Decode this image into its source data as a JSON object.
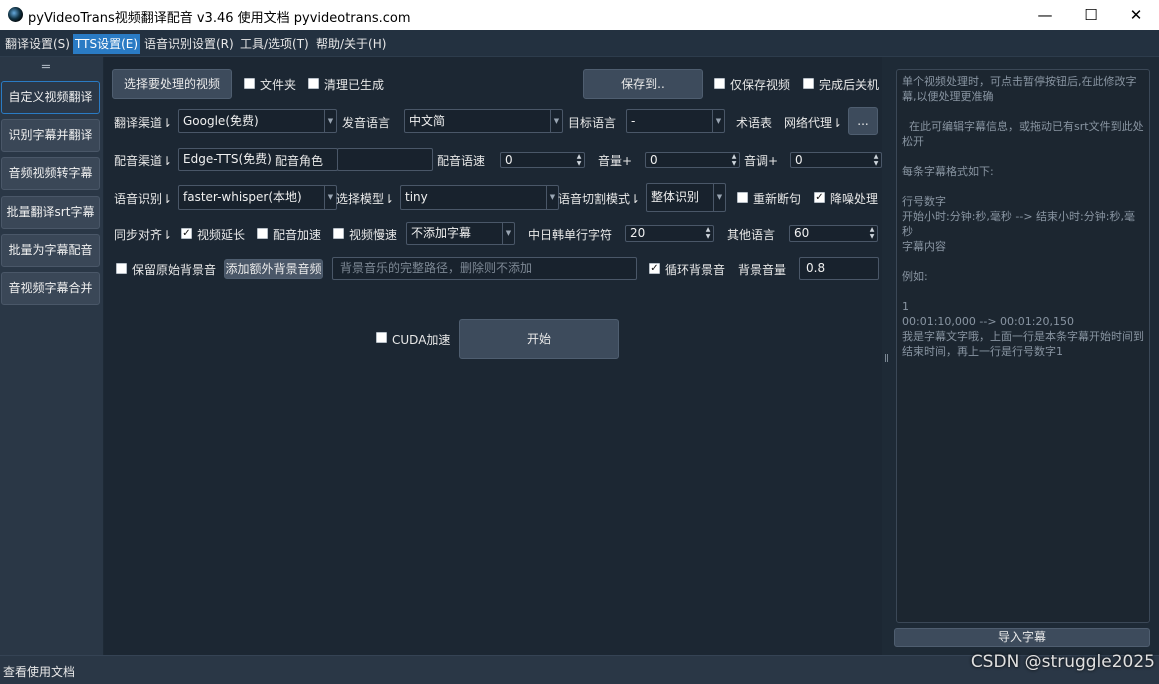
{
  "window": {
    "title": "pyVideoTrans视频翻译配音 v3.46  使用文档  pyvideotrans.com",
    "min": "—",
    "max": "☐",
    "close": "✕"
  },
  "menu": [
    "翻译设置(S)",
    "TTS设置(E)",
    "语音识别设置(R)",
    "工具/选项(T)",
    "帮助/关于(H)"
  ],
  "sidebar": {
    "handle": "═",
    "items": [
      "自定义视频翻译",
      "识别字幕并翻译",
      "音频视频转字幕",
      "批量翻译srt字幕",
      "批量为字幕配音",
      "音视频字幕合并"
    ]
  },
  "row1": {
    "select_video": "选择要处理的视频",
    "folder": "文件夹",
    "clean": "清理已生成",
    "save_to": "保存到..",
    "only_video": "仅保存视频",
    "shutdown": "完成后关机"
  },
  "row2": {
    "translate_label": "翻译渠道⇂",
    "translate_value": "Google(免费)",
    "voice_lang_label": "发音语言",
    "voice_lang_value": "中文简",
    "target_lang_label": "目标语言",
    "target_lang_value": "-",
    "glossary": "术语表",
    "proxy": "网络代理⇂",
    "more": "..."
  },
  "row3": {
    "dub_label": "配音渠道⇂",
    "dub_value": "Edge-TTS(免费)",
    "role_label": "配音角色",
    "role_value": "",
    "rate_label": "配音语速",
    "rate_value": "0",
    "volume_label": "音量+",
    "volume_value": "0",
    "pitch_label": "音调+",
    "pitch_value": "0"
  },
  "row4": {
    "asr_label": "语音识别⇂",
    "asr_value": "faster-whisper(本地)",
    "model_label": "选择模型⇂",
    "model_value": "tiny",
    "split_label": "语音切割模式⇂",
    "split_value": "整体识别",
    "resplit": "重新断句",
    "denoise": "降噪处理"
  },
  "row5": {
    "sync_label": "同步对齐⇂",
    "extend": "视频延长",
    "speedup": "配音加速",
    "slow": "视频慢速",
    "subtitle_value": "不添加字幕",
    "cjk_label": "中日韩单行字符",
    "cjk_value": "20",
    "other_label": "其他语言",
    "other_value": "60"
  },
  "row6": {
    "keep_bg": "保留原始背景音",
    "add_bg": "添加额外背景音频",
    "bg_placeholder": "背景音乐的完整路径，删除则不添加",
    "loop_bg": "循环背景音",
    "bg_volume_label": "背景音量",
    "bg_volume_value": "0.8"
  },
  "row7": {
    "cuda": "CUDA加速",
    "start": "开始"
  },
  "right": {
    "text": "单个视频处理时，可点击暂停按钮后,在此修改字幕,以便处理更准确\n\n  在此可编辑字幕信息，或拖动已有srt文件到此处松开\n\n每条字幕格式如下:\n\n行号数字\n开始小时:分钟:秒,毫秒 --> 结束小时:分钟:秒,毫秒\n字幕内容\n\n例如:\n\n1\n00:01:10,000 --> 00:01:20,150\n我是字幕文字哦，上面一行是本条字幕开始时间到结束时间，再上一行是行号数字1",
    "import_button": "导入字幕"
  },
  "status": {
    "text": "查看使用文档",
    "watermark": "CSDN @struggle2025"
  }
}
